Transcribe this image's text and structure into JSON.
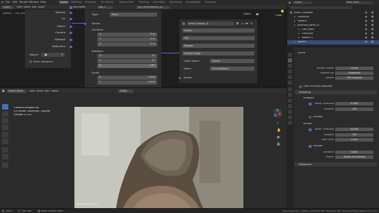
{
  "topbar": {
    "menus": [
      "File",
      "Edit",
      "Render",
      "Window",
      "Help"
    ],
    "workspaces": [
      "Layout",
      "Modeling",
      "Sculpting",
      "UV Editing",
      "Texture Paint",
      "Shading",
      "Animation",
      "Rendering",
      "Compositing",
      "Scripting"
    ],
    "active_workspace": "Layout",
    "scene": "Scene",
    "view_layer": "View Layer"
  },
  "node_editor": {
    "header": {
      "object_mode": "Object",
      "menus": [
        "View",
        "Select",
        "Add",
        "Node"
      ],
      "use_nodes_label": "Use Nodes",
      "slot": "Slot 1",
      "material": "hdri_environment_01"
    },
    "breadcrumb": [
      "Sphere",
      "hdri_environment_01"
    ],
    "tex_coord_outputs": [
      "Normal",
      "UV",
      "Object",
      "Camera",
      "Window",
      "Reflection"
    ],
    "tex_coord_object_label": "Object:",
    "from_instancer_label": "From Instancer",
    "mapping": {
      "type_label": "Type:",
      "type_value": "Point",
      "vector_label": "Vector",
      "location_label": "Location:",
      "location": [
        {
          "axis": "X",
          "value": "0 m"
        },
        {
          "axis": "Y",
          "value": "0 m"
        },
        {
          "axis": "Z",
          "value": "0 m"
        }
      ],
      "rotation_label": "Rotation:",
      "rotation": [
        {
          "axis": "X",
          "value": "0°"
        },
        {
          "axis": "Y",
          "value": "0°"
        },
        {
          "axis": "Z",
          "value": "4.8°"
        }
      ],
      "scale_label": "Scale:",
      "scale": [
        {
          "axis": "X",
          "value": "1.000"
        },
        {
          "axis": "Y",
          "value": "1.000"
        }
      ]
    },
    "env_texture": {
      "image_name": "small_hangar_0...",
      "interpolation": "Linear",
      "projection": "Flat",
      "extension": "Repeat",
      "source": "Single Image",
      "color_space_label": "Color Space",
      "color_space": "Linear",
      "alpha_label": "Alpha",
      "alpha": "Premultiplied",
      "vector_label": "Vector",
      "color_output": "Color",
      "alpha_output": "Alpha"
    }
  },
  "viewport": {
    "header": {
      "mode": "Object Mode",
      "menus": [
        "View",
        "Select",
        "Add",
        "Object"
      ],
      "transform": "Global",
      "options": "Options"
    },
    "overlay_text": [
      "Camera Perspective",
      "(0) Scene Collection | Sphere",
      "Sample 1/128"
    ],
    "camera_label": "Camera.007_main"
  },
  "outliner": {
    "title": "Scene Collection",
    "rows": [
      {
        "name": "Scene Collection",
        "indent": 0,
        "selected": false
      },
      {
        "name": "Collection",
        "indent": 1,
        "selected": false
      },
      {
        "name": "camera",
        "indent": 1,
        "selected": false
      },
      {
        "name": "practical_lights_01",
        "indent": 1,
        "selected": false
      },
      {
        "name": "Cam_Main",
        "indent": 2,
        "selected": false
      },
      {
        "name": "CamOrbit",
        "indent": 2,
        "selected": false
      },
      {
        "name": "camera 1",
        "indent": 2,
        "selected": false
      },
      {
        "name": "Sphere",
        "indent": 1,
        "selected": true
      }
    ]
  },
  "properties": {
    "breadcrumb": "Scene",
    "render_engine_label": "Render Engine",
    "render_engine": "Cycles",
    "feature_set_label": "Feature Set",
    "feature_set": "Supported",
    "device_label": "Device",
    "device": "GPU Compute",
    "open_shading_label": "Open Shading Language",
    "sampling_label": "Sampling",
    "viewport_label": "Viewport",
    "noise_threshold_label": "Noise Threshold",
    "viewport_noise_threshold": "0.1000",
    "samples_label": "Samples",
    "viewport_samples": "128",
    "denoise_label": "Denoise",
    "render_label": "Render",
    "render_noise_threshold": "0.0100",
    "render_samples": "128",
    "time_limit_label": "Time Limit",
    "time_limit": "0 sec",
    "render_denoise_label": "Denoise",
    "denoiser_label": "Denoiser",
    "denoiser": "OptiX",
    "passes_label": "Passes",
    "passes": "Albedo and Normal",
    "advanced_label": "Advanced"
  },
  "statusbar": {
    "left": [
      "Select",
      "Pan View",
      "Node Context Menu"
    ],
    "right": "Scene Collection | Sphere | Verts:512,315 | Faces:511,000 | Tris:1,022,000 | Objects:1/4 | 3.3.0"
  },
  "colors": {
    "accent": "#4772b3",
    "vector_socket": "#6363c7",
    "color_socket": "#c7c729",
    "gray_socket": "#a1a1a1"
  }
}
